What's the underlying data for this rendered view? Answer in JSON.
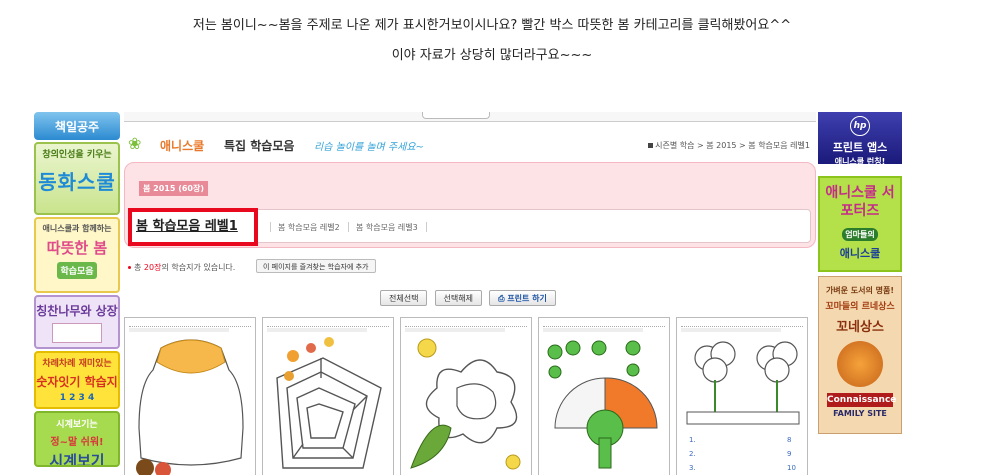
{
  "post": {
    "line1": "저는 봄이니~~봄을 주제로 나온 제가 표시한거보이시나요? 빨간 박스 따뜻한 봄  카테고리를  클릭해봤어요^^",
    "line2": "이야 자료가 상당히 많더라구요~~~"
  },
  "left_banners": {
    "b0": "책일공주",
    "b1_sub": "창의인성을 키우는",
    "b1_main": "동화스쿨",
    "b2_sub": "애니스쿨과 함께하는",
    "b2_main": "따뜻한 봄",
    "b2_tag": "학습모음",
    "b3_main": "칭찬나무와 상장",
    "b4_sub": "차례차례 재미있는",
    "b4_main": "숫자잇기 학습지",
    "b4_nums": "1 2 3 4",
    "b5_sub": "시계보기는",
    "b5_mid": "정~말 쉬워!",
    "b5_main": "시계보기"
  },
  "right_banners": {
    "hp": "hp",
    "r1_main": "프린트 앱스",
    "r1_sub": "애니스쿨 런칭!",
    "r2_main": "애니스쿨 서포터즈",
    "r2_tag": "엄마들의",
    "r2_sub": "애니스쿨",
    "r3_sub": "가벼운 도서의 명품!",
    "r3_mid": "꼬마들의 르네상스",
    "r3_main": "꼬네상스",
    "r3_logo": "Connaissance",
    "r3_family": "FAMILY SITE"
  },
  "header": {
    "brand": "애니스쿨",
    "title": "특집 학습모음",
    "slogan": "리습 놀이를 놀며 주세요~",
    "breadcrumb": "시즌별 학습 > 봄 2015 > 봄 학습모음 레벨1"
  },
  "section": {
    "label": "봄 2015 (60장)"
  },
  "tabs": [
    {
      "label": "봄 학습모음 레벨1",
      "active": true
    },
    {
      "label": "봄 학습모음 레벨2",
      "active": false
    },
    {
      "label": "봄 학습모음 레벨3",
      "active": false
    }
  ],
  "info": {
    "prefix": "총",
    "count": "20장",
    "suffix": "의 학습지가 있습니다.",
    "fav_button": "이 페이지를 즐겨찾는 학습자에 추가"
  },
  "buttons": {
    "select_all": "전체선택",
    "deselect": "선택해제",
    "print": "프린트 하기"
  },
  "thumbnails": [
    {
      "name": "worksheet-1"
    },
    {
      "name": "worksheet-2"
    },
    {
      "name": "worksheet-3"
    },
    {
      "name": "worksheet-4"
    },
    {
      "name": "worksheet-5"
    }
  ],
  "colors": {
    "highlight": "#e8091f",
    "brand_orange": "#e8782a",
    "pink_panel": "#fde2e6"
  }
}
